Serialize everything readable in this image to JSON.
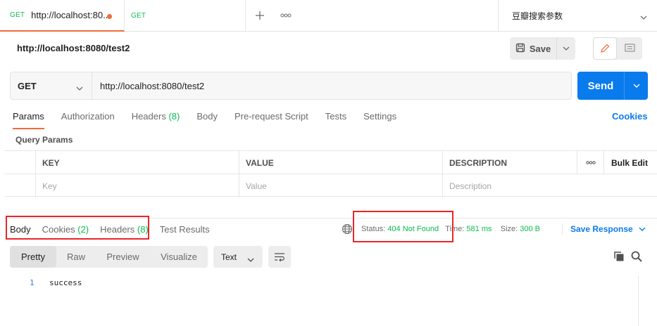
{
  "tabs": [
    {
      "method": "GET",
      "title": "http://localhost:80..."
    },
    {
      "method": "GET",
      "title": ""
    }
  ],
  "environment": "豆瓣搜索参数",
  "request": {
    "name": "http://localhost:8080/test2",
    "save_label": "Save",
    "method": "GET",
    "url": "http://localhost:8080/test2",
    "send_label": "Send"
  },
  "request_tabs": [
    {
      "label": "Params",
      "count": ""
    },
    {
      "label": "Authorization",
      "count": ""
    },
    {
      "label": "Headers",
      "count": "(8)"
    },
    {
      "label": "Body",
      "count": ""
    },
    {
      "label": "Pre-request Script",
      "count": ""
    },
    {
      "label": "Tests",
      "count": ""
    },
    {
      "label": "Settings",
      "count": ""
    }
  ],
  "cookies_link": "Cookies",
  "query_params": {
    "title": "Query Params",
    "headers": {
      "key": "KEY",
      "value": "VALUE",
      "description": "DESCRIPTION",
      "bulk_edit": "Bulk Edit"
    },
    "placeholders": {
      "key": "Key",
      "value": "Value",
      "description": "Description"
    }
  },
  "response_tabs": [
    {
      "label": "Body",
      "count": ""
    },
    {
      "label": "Cookies",
      "count": "(2)"
    },
    {
      "label": "Headers",
      "count": "(8)"
    },
    {
      "label": "Test Results",
      "count": ""
    }
  ],
  "response_meta": {
    "status_label": "Status:",
    "status_value": "404 Not Found",
    "time_label": "Time:",
    "time_value": "581 ms",
    "size_label": "Size:",
    "size_value": "300 B",
    "save_response": "Save Response"
  },
  "body_view": {
    "modes": [
      "Pretty",
      "Raw",
      "Preview",
      "Visualize"
    ],
    "active_mode": "Pretty",
    "format": "Text",
    "lines": [
      {
        "number": "1",
        "text": "success"
      }
    ]
  },
  "colors": {
    "accent": "#f26b3a",
    "primary": "#097bed",
    "success": "#0cbb52",
    "highlight": "#e8262b"
  }
}
